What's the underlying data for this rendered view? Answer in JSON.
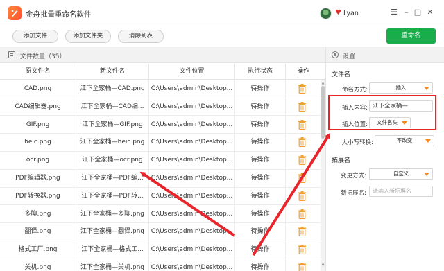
{
  "window": {
    "title": "金舟批量重命名软件",
    "username": "Lyan",
    "controls": [
      "☰",
      "–",
      "□",
      "✕"
    ]
  },
  "toolbar": {
    "add_file": "添加文件",
    "add_folder": "添加文件夹",
    "clear_list": "清除列表",
    "rename": "重命名"
  },
  "file_list": {
    "count_label": "文件数量（35）",
    "columns": [
      "原文件名",
      "新文件名",
      "文件位置",
      "执行状态",
      "操作"
    ],
    "rows": [
      {
        "orig": "CAD.png",
        "new": "江下全家桶—CAD.png",
        "path": "C:\\Users\\admin\\Desktop...",
        "status": "待操作"
      },
      {
        "orig": "CAD编辑器.png",
        "new": "江下全家桶—CAD编...",
        "path": "C:\\Users\\admin\\Desktop...",
        "status": "待操作"
      },
      {
        "orig": "GIF.png",
        "new": "江下全家桶—GIF.png",
        "path": "C:\\Users\\admin\\Desktop...",
        "status": "待操作"
      },
      {
        "orig": "heic.png",
        "new": "江下全家桶—heic.png",
        "path": "C:\\Users\\admin\\Desktop...",
        "status": "待操作"
      },
      {
        "orig": "ocr.png",
        "new": "江下全家桶—ocr.png",
        "path": "C:\\Users\\admin\\Desktop...",
        "status": "待操作"
      },
      {
        "orig": "PDF编辑器.png",
        "new": "江下全家桶—PDF编...",
        "path": "C:\\Users\\admin\\Desktop...",
        "status": "待操作"
      },
      {
        "orig": "PDF转换器.png",
        "new": "江下全家桶—PDF转...",
        "path": "C:\\Users\\admin\\Desktop...",
        "status": "待操作"
      },
      {
        "orig": "多聊.png",
        "new": "江下全家桶—多聊.png",
        "path": "C:\\Users\\admin\\Desktop...",
        "status": "待操作"
      },
      {
        "orig": "翻译.png",
        "new": "江下全家桶—翻译.png",
        "path": "C:\\Users\\admin\\Desktop...",
        "status": "待操作"
      },
      {
        "orig": "格式工厂.png",
        "new": "江下全家桶—格式工...",
        "path": "C:\\Users\\admin\\Desktop...",
        "status": "待操作"
      },
      {
        "orig": "关机.png",
        "new": "江下全家桶—关机.png",
        "path": "C:\\Users\\admin\\Desktop...",
        "status": "待操作"
      }
    ]
  },
  "settings": {
    "header": "设置",
    "filename_section": "文件名",
    "naming_mode_label": "命名方式:",
    "naming_mode_value": "插入",
    "insert_content_label": "插入内容:",
    "insert_content_value": "江下全家桶—",
    "insert_position_label": "插入位置:",
    "insert_position_value": "文件名头",
    "case_label": "大小写转换:",
    "case_value": "不改变",
    "ext_section": "拓展名",
    "change_mode_label": "变更方式:",
    "change_mode_value": "自定义",
    "new_ext_label": "新拓展名:",
    "new_ext_placeholder": "请输入新拓展名"
  },
  "colors": {
    "accent_green": "#1aad4b",
    "highlight_red": "#e8252a",
    "dropdown_orange": "#f28c1e",
    "trash_orange": "#f0a030"
  }
}
